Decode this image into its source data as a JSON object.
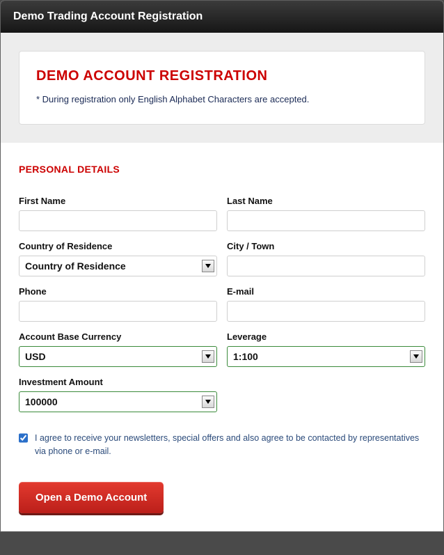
{
  "titlebar": "Demo Trading Account Registration",
  "header": {
    "title": "DEMO ACCOUNT REGISTRATION",
    "note": "* During registration only English Alphabet Characters are accepted."
  },
  "section_title": "PERSONAL DETAILS",
  "fields": {
    "first_name": {
      "label": "First Name",
      "value": ""
    },
    "last_name": {
      "label": "Last Name",
      "value": ""
    },
    "country": {
      "label": "Country of Residence",
      "value": "Country of Residence"
    },
    "city": {
      "label": "City / Town",
      "value": ""
    },
    "phone": {
      "label": "Phone",
      "value": ""
    },
    "email": {
      "label": "E-mail",
      "value": ""
    },
    "currency": {
      "label": "Account Base Currency",
      "value": "USD"
    },
    "leverage": {
      "label": "Leverage",
      "value": "1:100"
    },
    "investment": {
      "label": "Investment Amount",
      "value": "100000"
    }
  },
  "consent": {
    "checked": true,
    "text": "I agree to receive your newsletters, special offers and also agree to be contacted by representatives via phone or e-mail."
  },
  "submit_label": "Open a Demo Account"
}
